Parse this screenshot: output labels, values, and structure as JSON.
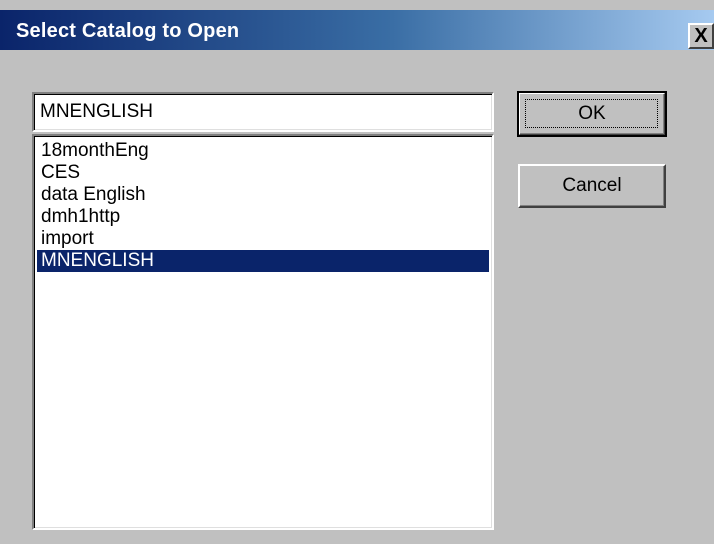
{
  "window": {
    "title": "Select Catalog to Open",
    "close_glyph": "X"
  },
  "name_field": {
    "value": "MNENGLISH"
  },
  "catalog_list": {
    "items": [
      {
        "label": "18monthEng",
        "selected": false
      },
      {
        "label": "CES",
        "selected": false
      },
      {
        "label": "data English",
        "selected": false
      },
      {
        "label": "dmh1http",
        "selected": false
      },
      {
        "label": "import",
        "selected": false
      },
      {
        "label": "MNENGLISH",
        "selected": true
      }
    ]
  },
  "buttons": {
    "ok_label": "OK",
    "cancel_label": "Cancel"
  },
  "colors": {
    "selection_background": "#0a246a",
    "titlebar_start": "#0a246a",
    "titlebar_end": "#a6caf0",
    "dialog_face": "#c0c0c0"
  }
}
